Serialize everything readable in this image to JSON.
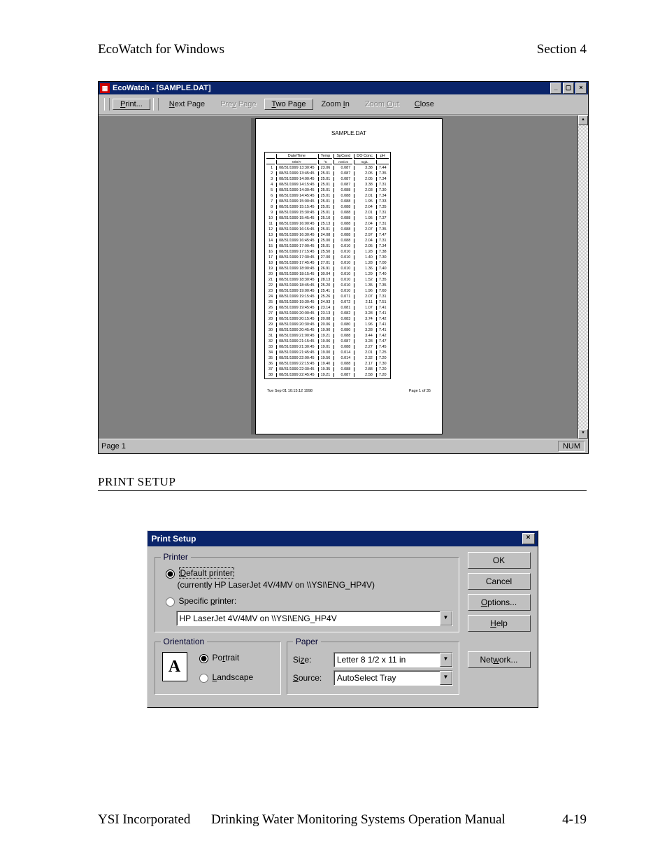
{
  "header": {
    "left": "EcoWatch for Windows",
    "right": "Section 4"
  },
  "ecowatch": {
    "title": "EcoWatch - [SAMPLE.DAT]",
    "toolbar": {
      "print": "Print...",
      "next": "Next Page",
      "prev": "Prev Page",
      "two": "Two Page",
      "zin": "Zoom In",
      "zout": "Zoom Out",
      "close": "Close"
    },
    "preview": {
      "file": "SAMPLE.DAT",
      "columns": [
        "Date/Time",
        "Temp",
        "SpCond",
        "DO Conc",
        "pH"
      ],
      "units": [
        "M/D/Y",
        "°C",
        "mS/cm",
        "mg/L",
        ""
      ],
      "rows": [
        [
          "1",
          "08/31/1999 13:30:45",
          "23.06",
          "0.087",
          "3.38",
          "7.44"
        ],
        [
          "2",
          "08/31/1999 13:45:45",
          "25.01",
          "0.087",
          "2.05",
          "7.35"
        ],
        [
          "3",
          "08/31/1999 14:00:45",
          "25.01",
          "0.087",
          "2.05",
          "7.34"
        ],
        [
          "4",
          "08/31/1999 14:15:45",
          "25.01",
          "0.087",
          "3.38",
          "7.31"
        ],
        [
          "5",
          "08/31/1999 14:30:45",
          "25.01",
          "0.088",
          "2.03",
          "7.30"
        ],
        [
          "6",
          "08/31/1999 14:45:45",
          "25.01",
          "0.088",
          "2.01",
          "7.34"
        ],
        [
          "7",
          "08/31/1999 15:00:45",
          "25.01",
          "0.088",
          "1.95",
          "7.33"
        ],
        [
          "8",
          "08/31/1999 15:15:45",
          "25.01",
          "0.088",
          "2.04",
          "7.35"
        ],
        [
          "9",
          "08/31/1999 15:30:45",
          "25.01",
          "0.088",
          "2.01",
          "7.31"
        ],
        [
          "10",
          "08/31/1999 15:45:45",
          "25.10",
          "0.088",
          "1.95",
          "7.37"
        ],
        [
          "11",
          "08/31/1999 16:00:45",
          "25.13",
          "0.088",
          "2.04",
          "7.31"
        ],
        [
          "12",
          "08/31/1999 16:15:45",
          "25.01",
          "0.088",
          "2.07",
          "7.35"
        ],
        [
          "13",
          "08/31/1999 16:30:45",
          "24.08",
          "0.088",
          "2.97",
          "7.47"
        ],
        [
          "14",
          "08/31/1999 16:45:45",
          "25.00",
          "0.088",
          "2.04",
          "7.31"
        ],
        [
          "15",
          "08/31/1999 17:00:45",
          "25.01",
          "0.010",
          "2.05",
          "7.34"
        ],
        [
          "16",
          "08/31/1999 17:15:45",
          "25.50",
          "0.010",
          "1.28",
          "7.38"
        ],
        [
          "17",
          "08/31/1999 17:30:45",
          "27.00",
          "0.010",
          "1.40",
          "7.30"
        ],
        [
          "18",
          "08/31/1999 17:45:45",
          "27.01",
          "0.010",
          "1.28",
          "7.00"
        ],
        [
          "19",
          "08/31/1999 18:00:45",
          "26.91",
          "0.010",
          "1.36",
          "7.40"
        ],
        [
          "20",
          "08/31/1999 18:15:45",
          "30.04",
          "0.010",
          "1.29",
          "7.40"
        ],
        [
          "21",
          "08/31/1999 18:30:45",
          "28.13",
          "0.010",
          "1.52",
          "7.35"
        ],
        [
          "22",
          "08/31/1999 18:45:45",
          "25.20",
          "0.010",
          "1.35",
          "7.35"
        ],
        [
          "23",
          "08/31/1999 19:00:45",
          "25.41",
          "0.010",
          "1.96",
          "7.60"
        ],
        [
          "24",
          "08/31/1999 19:15:45",
          "25.26",
          "0.071",
          "2.07",
          "7.31"
        ],
        [
          "25",
          "08/31/1999 19:30:45",
          "24.93",
          "0.072",
          "2.11",
          "7.51"
        ],
        [
          "26",
          "08/31/1999 19:45:45",
          "23.14",
          "0.081",
          "1.07",
          "7.41"
        ],
        [
          "27",
          "08/31/1999 20:00:45",
          "23.13",
          "0.082",
          "3.28",
          "7.41"
        ],
        [
          "28",
          "08/31/1999 20:15:45",
          "20.08",
          "0.083",
          "3.74",
          "7.42"
        ],
        [
          "29",
          "08/31/1999 20:30:45",
          "20.06",
          "0.080",
          "1.96",
          "7.41"
        ],
        [
          "30",
          "08/31/1999 20:45:45",
          "19.90",
          "0.080",
          "3.28",
          "7.41"
        ],
        [
          "31",
          "08/31/1999 21:00:45",
          "19.21",
          "0.088",
          "3.44",
          "7.42"
        ],
        [
          "32",
          "08/31/1999 21:15:45",
          "19.06",
          "0.087",
          "3.28",
          "7.47"
        ],
        [
          "33",
          "08/31/1999 21:30:45",
          "19.01",
          "0.088",
          "2.27",
          "7.45"
        ],
        [
          "34",
          "08/31/1999 21:45:45",
          "19.00",
          "0.014",
          "2.01",
          "7.25"
        ],
        [
          "35",
          "08/31/1999 22:00:45",
          "19.56",
          "0.014",
          "2.32",
          "7.20"
        ],
        [
          "36",
          "08/31/1999 22:15:45",
          "19.40",
          "0.088",
          "2.17",
          "7.30"
        ],
        [
          "37",
          "08/31/1999 22:30:45",
          "19.35",
          "0.088",
          "2.88",
          "7.20"
        ],
        [
          "38",
          "08/31/1999 22:45:45",
          "19.21",
          "0.087",
          "2.58",
          "7.20"
        ]
      ],
      "foot_left": "Tue Sep 01 10:15:12 1998",
      "foot_right": "Page 1 of 35"
    },
    "status": {
      "page": "Page 1",
      "num": "NUM"
    }
  },
  "section_heading": "PRINT SETUP",
  "print_setup": {
    "title": "Print Setup",
    "printer_group": "Printer",
    "default_label": "Default printer",
    "default_detail": "(currently HP LaserJet 4V/4MV on \\\\YSI\\ENG_HP4V)",
    "specific_label": "Specific printer:",
    "printer_value": "HP LaserJet 4V/4MV on \\\\YSI\\ENG_HP4V",
    "orientation_group": "Orientation",
    "portrait": "Portrait",
    "landscape": "Landscape",
    "paper_group": "Paper",
    "size_label": "Size:",
    "size_value": "Letter 8 1/2 x 11 in",
    "source_label": "Source:",
    "source_value": "AutoSelect Tray",
    "buttons": {
      "ok": "OK",
      "cancel": "Cancel",
      "options": "Options...",
      "help": "Help",
      "network": "Network..."
    }
  },
  "footer": {
    "left": "YSI Incorporated",
    "mid": "Drinking Water Monitoring Systems Operation Manual",
    "right": "4-19"
  }
}
